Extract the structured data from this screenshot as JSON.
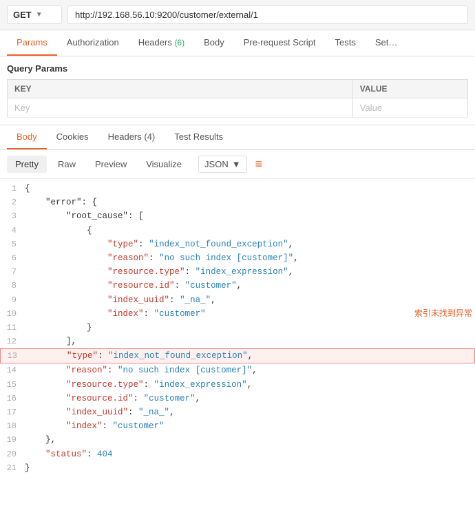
{
  "url_bar": {
    "method": "GET",
    "chevron": "▼",
    "url": "http://192.168.56.10:9200/customer/external/1"
  },
  "request_tabs": [
    {
      "id": "params",
      "label": "Params",
      "badge": null,
      "active": true
    },
    {
      "id": "authorization",
      "label": "Authorization",
      "badge": null,
      "active": false
    },
    {
      "id": "headers",
      "label": "Headers",
      "badge": "(6)",
      "active": false
    },
    {
      "id": "body",
      "label": "Body",
      "badge": null,
      "active": false
    },
    {
      "id": "prerequest",
      "label": "Pre-request Script",
      "badge": null,
      "active": false
    },
    {
      "id": "tests",
      "label": "Tests",
      "badge": null,
      "active": false
    },
    {
      "id": "settings",
      "label": "Set…",
      "badge": null,
      "active": false
    }
  ],
  "query_params": {
    "title": "Query Params",
    "key_header": "KEY",
    "value_header": "VALUE",
    "key_placeholder": "Key",
    "value_placeholder": "Value"
  },
  "response_tabs": [
    {
      "id": "body",
      "label": "Body",
      "active": true
    },
    {
      "id": "cookies",
      "label": "Cookies",
      "active": false
    },
    {
      "id": "headers",
      "label": "Headers (4)",
      "active": false
    },
    {
      "id": "test_results",
      "label": "Test Results",
      "active": false
    }
  ],
  "body_toolbar": {
    "pretty_label": "Pretty",
    "raw_label": "Raw",
    "preview_label": "Preview",
    "visualize_label": "Visualize",
    "format_label": "JSON",
    "chevron": "▼",
    "wrap_symbol": "≡"
  },
  "json_lines": [
    {
      "num": 1,
      "content": "{",
      "highlight": false,
      "annotation": ""
    },
    {
      "num": 2,
      "content": "    \"error\": {",
      "highlight": false,
      "annotation": ""
    },
    {
      "num": 3,
      "content": "        \"root_cause\": [",
      "highlight": false,
      "annotation": ""
    },
    {
      "num": 4,
      "content": "            {",
      "highlight": false,
      "annotation": ""
    },
    {
      "num": 5,
      "content": "                \"type\": \"index_not_found_exception\",",
      "highlight": false,
      "annotation": ""
    },
    {
      "num": 6,
      "content": "                \"reason\": \"no such index [customer]\",",
      "highlight": false,
      "annotation": ""
    },
    {
      "num": 7,
      "content": "                \"resource.type\": \"index_expression\",",
      "highlight": false,
      "annotation": ""
    },
    {
      "num": 8,
      "content": "                \"resource.id\": \"customer\",",
      "highlight": false,
      "annotation": ""
    },
    {
      "num": 9,
      "content": "                \"index_uuid\": \"_na_\",",
      "highlight": false,
      "annotation": ""
    },
    {
      "num": 10,
      "content": "                \"index\": \"customer\"",
      "highlight": false,
      "annotation": "索引未找到异常"
    },
    {
      "num": 11,
      "content": "            }",
      "highlight": false,
      "annotation": ""
    },
    {
      "num": 12,
      "content": "        ],",
      "highlight": false,
      "annotation": ""
    },
    {
      "num": 13,
      "content": "        \"type\": \"index_not_found_exception\",",
      "highlight": true,
      "annotation": ""
    },
    {
      "num": 14,
      "content": "        \"reason\": \"no such index [customer]\",",
      "highlight": false,
      "annotation": ""
    },
    {
      "num": 15,
      "content": "        \"resource.type\": \"index_expression\",",
      "highlight": false,
      "annotation": ""
    },
    {
      "num": 16,
      "content": "        \"resource.id\": \"customer\",",
      "highlight": false,
      "annotation": ""
    },
    {
      "num": 17,
      "content": "        \"index_uuid\": \"_na_\",",
      "highlight": false,
      "annotation": ""
    },
    {
      "num": 18,
      "content": "        \"index\": \"customer\"",
      "highlight": false,
      "annotation": ""
    },
    {
      "num": 19,
      "content": "    },",
      "highlight": false,
      "annotation": ""
    },
    {
      "num": 20,
      "content": "    \"status\": 404",
      "highlight": false,
      "annotation": ""
    },
    {
      "num": 21,
      "content": "}",
      "highlight": false,
      "annotation": ""
    }
  ]
}
